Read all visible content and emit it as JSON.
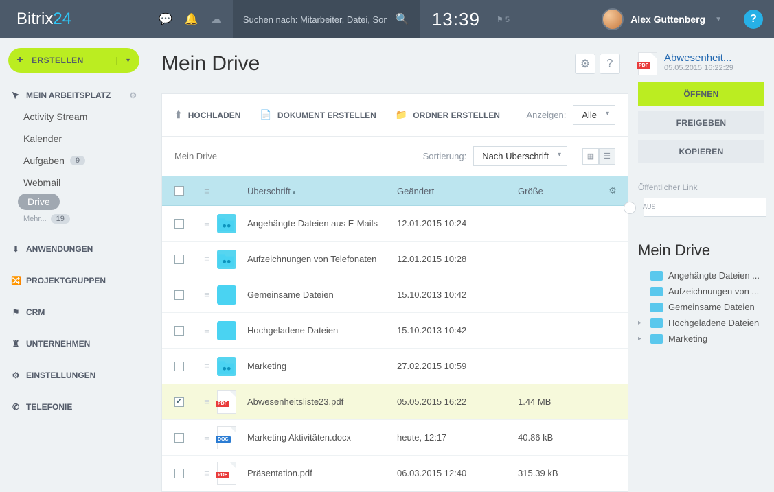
{
  "brand": {
    "a": "Bitrix",
    "b": "24"
  },
  "search": {
    "placeholder": "Suchen nach: Mitarbeiter, Datei, Sonstiges"
  },
  "clock": "13:39",
  "flag_count": "5",
  "user": {
    "name": "Alex Guttenberg"
  },
  "create_btn": "ERSTELLEN",
  "sidebar": {
    "workspace": {
      "title": "MEIN ARBEITSPLATZ",
      "items": [
        {
          "label": "Activity Stream"
        },
        {
          "label": "Kalender"
        },
        {
          "label": "Aufgaben",
          "badge": "9"
        },
        {
          "label": "Webmail"
        },
        {
          "label": "Drive",
          "active": true
        }
      ],
      "more": "Mehr...",
      "more_badge": "19"
    },
    "sections": [
      {
        "label": "ANWENDUNGEN",
        "icon": "download"
      },
      {
        "label": "PROJEKTGRUPPEN",
        "icon": "share"
      },
      {
        "label": "CRM",
        "icon": "flag"
      },
      {
        "label": "UNTERNEHMEN",
        "icon": "tower"
      },
      {
        "label": "EINSTELLUNGEN",
        "icon": "gear"
      },
      {
        "label": "TELEFONIE",
        "icon": "phone"
      }
    ]
  },
  "page_title": "Mein Drive",
  "toolbar": {
    "upload": "HOCHLADEN",
    "newdoc": "DOKUMENT ERSTELLEN",
    "newfolder": "ORDNER ERSTELLEN",
    "show_label": "Anzeigen:",
    "show_value": "Alle"
  },
  "breadcrumb": "Mein Drive",
  "sort_label": "Sortierung:",
  "sort_value": "Nach Überschrift",
  "columns": {
    "name": "Überschrift",
    "modified": "Geändert",
    "size": "Größe"
  },
  "rows": [
    {
      "type": "folder-shared",
      "name": "Angehängte Dateien aus E-Mails",
      "modified": "12.01.2015 10:24",
      "size": ""
    },
    {
      "type": "folder-shared",
      "name": "Aufzeichnungen von Telefonaten",
      "modified": "12.01.2015 10:28",
      "size": ""
    },
    {
      "type": "folder",
      "name": "Gemeinsame Dateien",
      "modified": "15.10.2013 10:42",
      "size": ""
    },
    {
      "type": "folder",
      "name": "Hochgeladene Dateien",
      "modified": "15.10.2013 10:42",
      "size": ""
    },
    {
      "type": "folder-shared",
      "name": "Marketing",
      "modified": "27.02.2015 10:59",
      "size": ""
    },
    {
      "type": "pdf",
      "name": "Abwesenheitsliste23.pdf",
      "modified": "05.05.2015 16:22",
      "size": "1.44 MB",
      "selected": true
    },
    {
      "type": "doc",
      "name": "Marketing Aktivitäten.docx",
      "modified": "heute, 12:17",
      "size": "40.86 kB"
    },
    {
      "type": "pdf",
      "name": "Präsentation.pdf",
      "modified": "06.03.2015 12:40",
      "size": "315.39 kB"
    }
  ],
  "detail": {
    "filename": "Abwesenheit...",
    "date": "05.05.2015 16:22:29",
    "open": "ÖFFNEN",
    "share": "FREIGEBEN",
    "copy": "KOPIEREN",
    "publink_label": "Öffentlicher Link",
    "switch_off": "AUS",
    "tree_title": "Mein Drive",
    "tree": [
      {
        "label": "Angehängte Dateien ...",
        "exp": false
      },
      {
        "label": "Aufzeichnungen von ...",
        "exp": false
      },
      {
        "label": "Gemeinsame Dateien",
        "exp": false
      },
      {
        "label": "Hochgeladene Dateien",
        "exp": true
      },
      {
        "label": "Marketing",
        "exp": true
      }
    ]
  }
}
